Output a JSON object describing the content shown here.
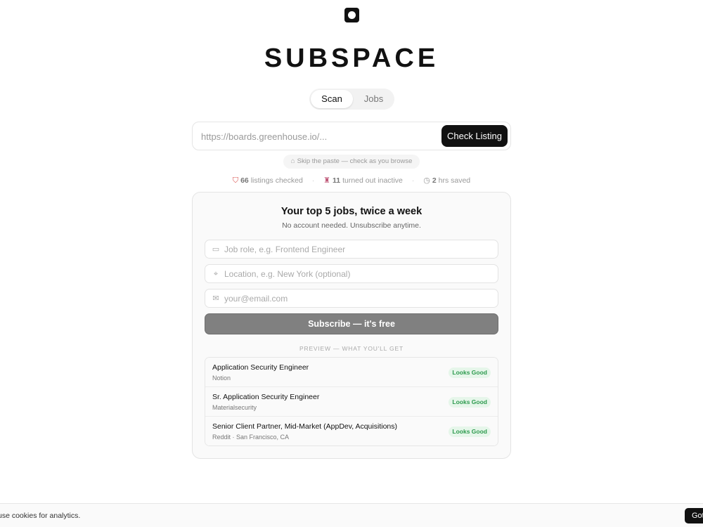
{
  "brand": {
    "logo_icon": "camera-shutter-icon",
    "title": "SUBSPACE"
  },
  "tabs": [
    {
      "label": "Scan",
      "active": true
    },
    {
      "label": "Jobs",
      "active": false
    }
  ],
  "url_bar": {
    "placeholder": "https://boards.greenhouse.io/...",
    "button_label": "Check Listing"
  },
  "extension_hint": {
    "icon": "extension-icon",
    "label": "Skip the paste — check as you browse"
  },
  "stats": [
    {
      "icon": "shield-icon",
      "value": "66",
      "label": "listings checked"
    },
    {
      "icon": "ghost-icon",
      "value": "11",
      "label": "turned out inactive"
    },
    {
      "icon": "timer-icon",
      "value": "2",
      "label": "hrs saved"
    }
  ],
  "subscribe": {
    "title": "Your top 5 jobs, twice a week",
    "subtitle": "No account needed. Unsubscribe anytime.",
    "role_placeholder": "Job role, e.g. Frontend Engineer",
    "location_placeholder": "Location, e.g. New York (optional)",
    "email_placeholder": "your@email.com",
    "button_label": "Subscribe — it's free",
    "preview_label": "PREVIEW — WHAT YOU'LL GET"
  },
  "preview_jobs": [
    {
      "title": "Application Security Engineer",
      "company": "Notion",
      "status": "Looks Good"
    },
    {
      "title": "Sr. Application Security Engineer",
      "company": "Materialsecurity",
      "status": "Looks Good"
    },
    {
      "title": "Senior Client Partner, Mid-Market (AppDev, Acquisitions)",
      "company": "Reddit · San Francisco, CA",
      "status": "Looks Good"
    }
  ],
  "cookie": {
    "text": "use cookies for analytics.",
    "button_label": "Got it"
  },
  "colors": {
    "badge_bg": "#e6f6ea",
    "badge_text": "#2d9a4e",
    "primary": "#111111",
    "subscribe_button": "#808080"
  }
}
